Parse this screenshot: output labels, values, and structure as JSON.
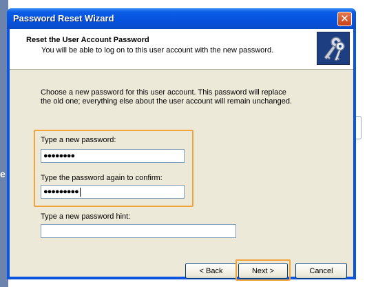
{
  "window": {
    "title": "Password Reset Wizard"
  },
  "header": {
    "title": "Reset the User Account Password",
    "subtitle": "You will be able to log on to this user account with the new password."
  },
  "description": {
    "line1": "Choose a new password for this user account. This password will replace",
    "line2": "the old one; everything else about the user account will remain unchanged."
  },
  "fields": {
    "new_password_label": "Type a new password:",
    "new_password_value": "●●●●●●●●",
    "confirm_label": "Type the password again to confirm:",
    "confirm_value": "●●●●●●●●●",
    "hint_label": "Type a new password hint:",
    "hint_value": ""
  },
  "buttons": {
    "back": "< Back",
    "next": "Next >",
    "cancel": "Cancel"
  },
  "background": {
    "partial_letter": "e"
  },
  "colors": {
    "titlebar": "#0652dd",
    "dialog_face": "#ece9d8",
    "highlight": "#f2a33a",
    "close_button": "#c9411b"
  },
  "icons": {
    "header": "keys-icon",
    "close": "close-icon"
  }
}
